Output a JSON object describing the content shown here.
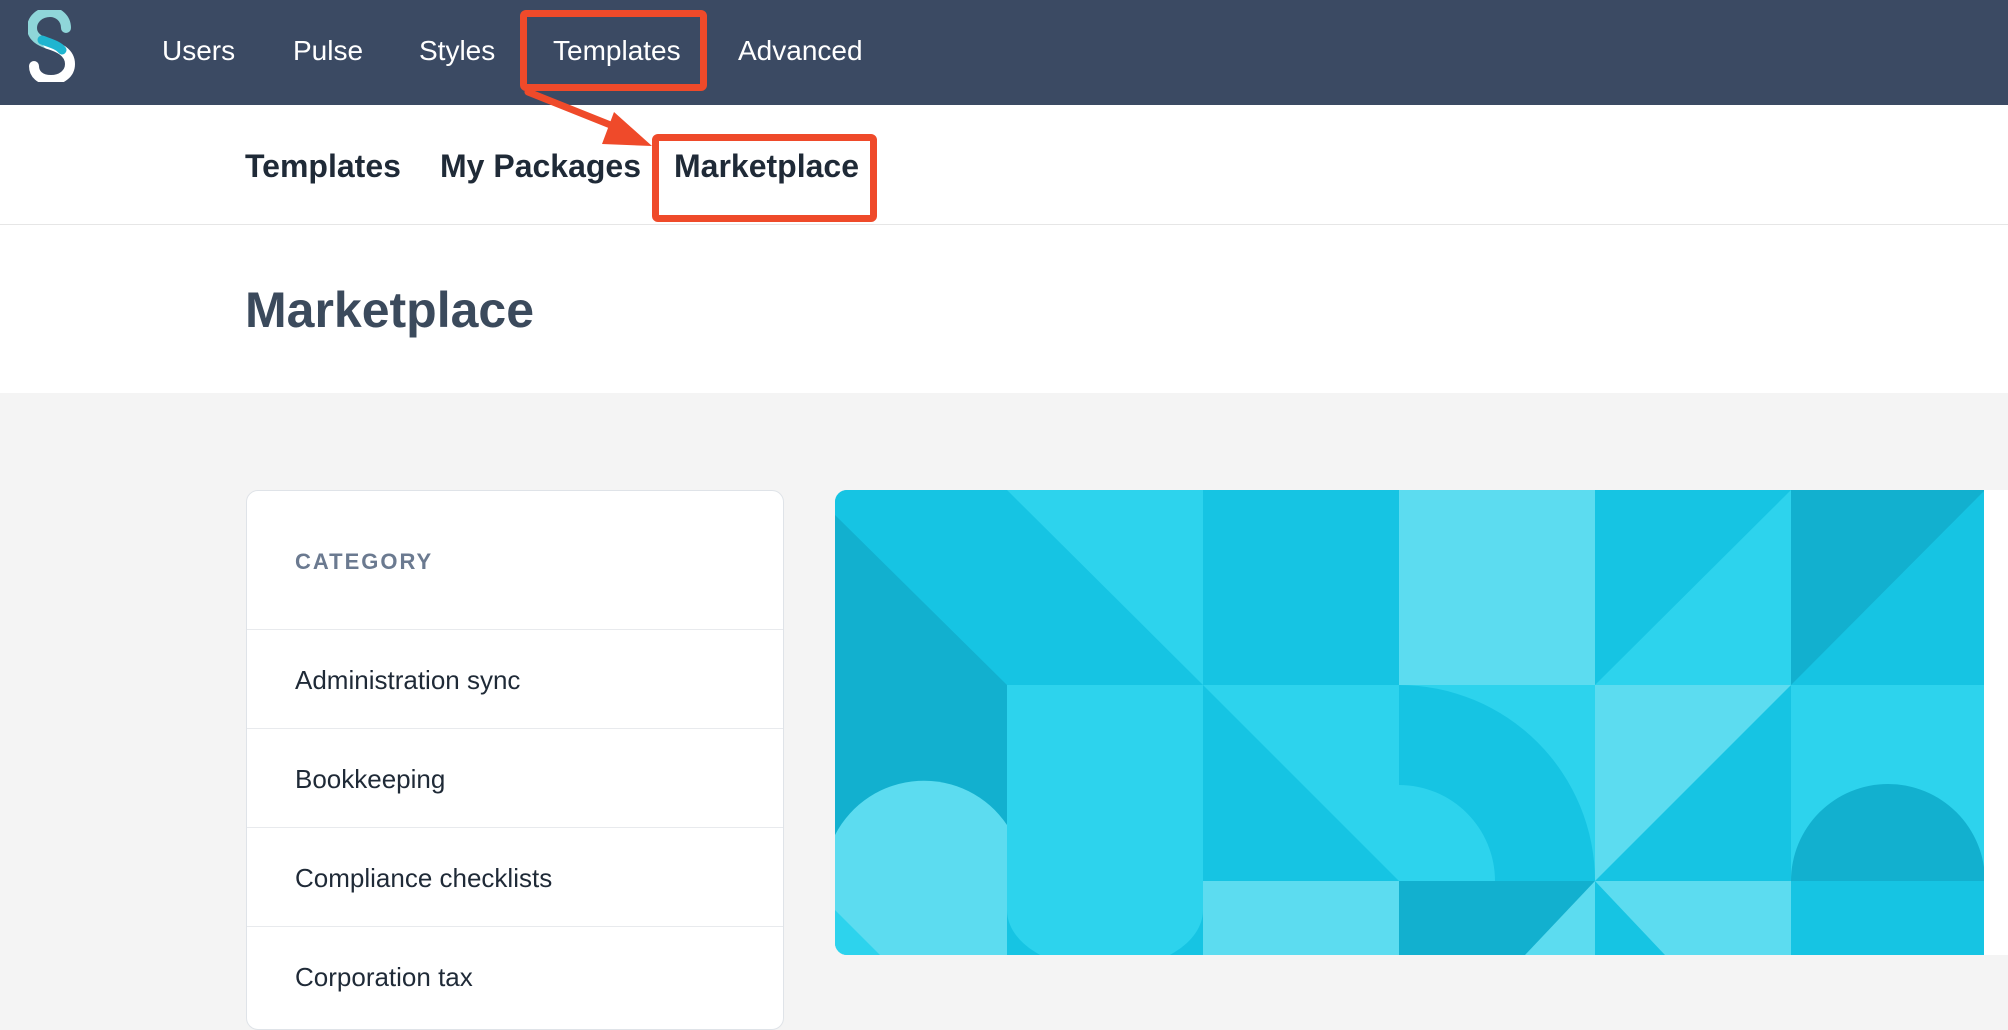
{
  "topnav": {
    "items": [
      {
        "label": "Users"
      },
      {
        "label": "Pulse"
      },
      {
        "label": "Styles"
      },
      {
        "label": "Templates"
      },
      {
        "label": "Advanced"
      }
    ]
  },
  "subnav": {
    "items": [
      {
        "label": "Templates"
      },
      {
        "label": "My Packages"
      },
      {
        "label": "Marketplace"
      }
    ]
  },
  "page": {
    "title": "Marketplace"
  },
  "category": {
    "heading": "CATEGORY",
    "items": [
      {
        "label": "Administration sync"
      },
      {
        "label": "Bookkeeping"
      },
      {
        "label": "Compliance checklists"
      },
      {
        "label": "Corporation tax"
      }
    ]
  },
  "colors": {
    "topbar": "#3b4a63",
    "accent": "#16c4e3",
    "annotation": "#ef4a2a"
  },
  "icons": {
    "logo": "brand-s-logo-icon"
  }
}
